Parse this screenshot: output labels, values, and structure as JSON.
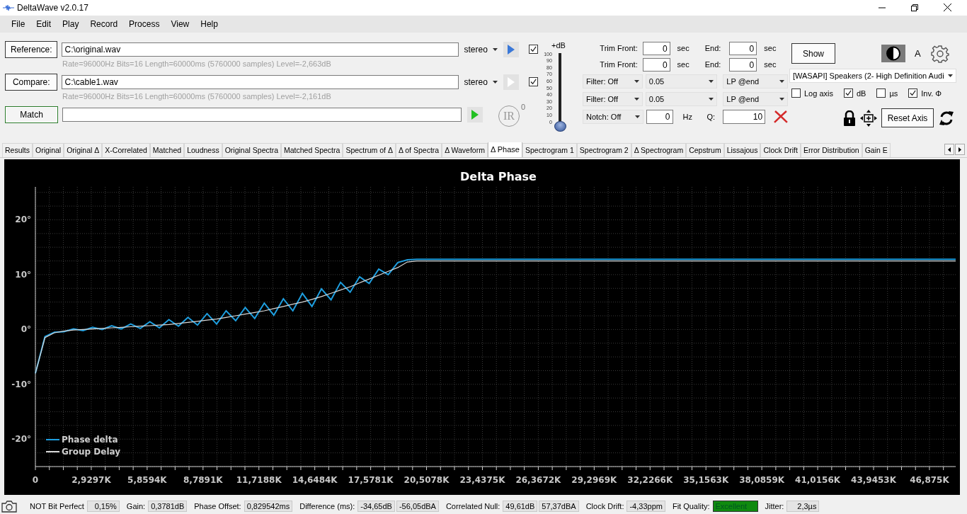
{
  "window": {
    "title": "DeltaWave v2.0.17"
  },
  "menu": [
    "File",
    "Edit",
    "Play",
    "Record",
    "Process",
    "View",
    "Help"
  ],
  "files": [
    {
      "button": "Reference:",
      "path": "C:\\original.wav",
      "info": "Rate=96000Hz Bits=16 Length=60000ms (5760000 samples) Level=-2,663dB",
      "channel": "stereo",
      "play_enabled": true,
      "checked": true
    },
    {
      "button": "Compare:",
      "path": "C:\\cable1.wav",
      "info": "Rate=96000Hz Bits=16 Length=60000ms (5760000 samples) Level=-2,161dB",
      "channel": "stereo",
      "play_enabled": false,
      "checked": true
    }
  ],
  "match": {
    "button": "Match"
  },
  "ir": {
    "label": "IR",
    "count": "0"
  },
  "volume": {
    "label": "+dB",
    "scale": [
      "100",
      "90",
      "80",
      "70",
      "60",
      "50",
      "40",
      "30",
      "20",
      "10",
      "0"
    ],
    "level": 0
  },
  "trims": [
    {
      "label": "Trim Front:",
      "value": "0",
      "unit": "sec",
      "end_label": "End:",
      "end_value": "0",
      "end_unit": "sec"
    },
    {
      "label": "Trim Front:",
      "value": "0",
      "unit": "sec",
      "end_label": "End:",
      "end_value": "0",
      "end_unit": "sec"
    }
  ],
  "filters": [
    {
      "filter": "Filter: Off",
      "frequency": "0.05",
      "mode": "LP @end"
    },
    {
      "filter": "Filter: Off",
      "frequency": "0.05",
      "mode": "LP @end"
    }
  ],
  "notch": {
    "filter": "Notch: Off",
    "value": "0",
    "unit": "Hz",
    "q_label": "Q:",
    "q_value": "10"
  },
  "show_button": "Show",
  "font_button": "A",
  "device": "[WASAPI] Speakers (2- High Definition Audi",
  "options": [
    {
      "label": "Log axis",
      "checked": false
    },
    {
      "label": "dB",
      "checked": true
    },
    {
      "label": "µs",
      "checked": false
    },
    {
      "label": "Inv. Φ",
      "checked": true
    }
  ],
  "reset_button": "Reset Axis",
  "tabs": [
    {
      "label": "Results",
      "selected": false
    },
    {
      "label": "Original",
      "selected": false
    },
    {
      "label": "Original Δ",
      "selected": false
    },
    {
      "label": "X-Correlated",
      "selected": false
    },
    {
      "label": "Matched",
      "selected": false
    },
    {
      "label": "Loudness",
      "selected": false
    },
    {
      "label": "Original Spectra",
      "selected": false
    },
    {
      "label": "Matched Spectra",
      "selected": false
    },
    {
      "label": "Spectrum of Δ",
      "selected": false
    },
    {
      "label": "Δ of Spectra",
      "selected": false
    },
    {
      "label": "Δ Waveform",
      "selected": false
    },
    {
      "label": "Δ Phase",
      "selected": true
    },
    {
      "label": "Spectrogram 1",
      "selected": false
    },
    {
      "label": "Spectrogram 2",
      "selected": false
    },
    {
      "label": "Δ Spectrogram",
      "selected": false
    },
    {
      "label": "Cepstrum",
      "selected": false
    },
    {
      "label": "Lissajous",
      "selected": false
    },
    {
      "label": "Clock Drift",
      "selected": false
    },
    {
      "label": "Error Distribution",
      "selected": false
    },
    {
      "label": "Gain E",
      "selected": false
    }
  ],
  "chart": {
    "chart_data": {
      "type": "line",
      "title": "Delta Phase",
      "x": [
        0,
        500,
        1000,
        1500,
        2000,
        2500,
        3000,
        3500,
        4000,
        4500,
        5000,
        5500,
        6000,
        6500,
        7000,
        7500,
        8000,
        8500,
        9000,
        9500,
        10000,
        10500,
        11000,
        11500,
        12000,
        12500,
        13000,
        13500,
        14000,
        14500,
        15000,
        15500,
        16000,
        16500,
        17000,
        17500,
        18000,
        18500,
        19000,
        19500,
        20000,
        48250
      ],
      "series": [
        {
          "name": "Phase delta",
          "color": "#1e9fe0",
          "values": [
            -8,
            -1.3,
            -0.5,
            -0.4,
            0.1,
            -0.2,
            0.4,
            0.0,
            0.7,
            0.1,
            1.0,
            0.2,
            1.4,
            0.3,
            1.8,
            0.6,
            2.2,
            0.8,
            2.9,
            1.0,
            3.4,
            1.6,
            4.0,
            2.0,
            4.8,
            2.6,
            5.6,
            3.4,
            6.6,
            4.2,
            7.4,
            5.4,
            8.6,
            6.8,
            9.6,
            8.4,
            11.0,
            10.0,
            12.2,
            12.7,
            12.8,
            12.8
          ]
        },
        {
          "name": "Group Delay",
          "color": "#d8d8d8",
          "values": [
            -8,
            -1.5,
            -0.6,
            -0.3,
            -0.1,
            0,
            0.1,
            0.2,
            0.3,
            0.4,
            0.5,
            0.6,
            0.7,
            0.8,
            0.9,
            1.1,
            1.3,
            1.5,
            1.7,
            1.9,
            2.2,
            2.5,
            2.8,
            3.1,
            3.4,
            3.8,
            4.2,
            4.6,
            5.0,
            5.5,
            6.0,
            6.6,
            7.2,
            7.8,
            8.5,
            9.2,
            9.9,
            10.6,
            11.3,
            12.3,
            12.5,
            12.5
          ]
        }
      ],
      "xlim": [
        0,
        48250
      ],
      "ylim": [
        -25,
        26
      ],
      "grid": true,
      "legend": true,
      "xticks": [
        {
          "value": 0,
          "label": "0"
        },
        {
          "value": 2929.6875,
          "label": "2,9297K"
        },
        {
          "value": 5859.375,
          "label": "5,8594K"
        },
        {
          "value": 8789.0625,
          "label": "8,7891K"
        },
        {
          "value": 11718.75,
          "label": "11,7188K"
        },
        {
          "value": 14648.4375,
          "label": "14,6484K"
        },
        {
          "value": 17578.125,
          "label": "17,5781K"
        },
        {
          "value": 20507.8125,
          "label": "20,5078K"
        },
        {
          "value": 23437.5,
          "label": "23,4375K"
        },
        {
          "value": 26367.1875,
          "label": "26,3672K"
        },
        {
          "value": 29296.875,
          "label": "29,2969K"
        },
        {
          "value": 32226.5625,
          "label": "32,2266K"
        },
        {
          "value": 35156.25,
          "label": "35,1563K"
        },
        {
          "value": 38085.9375,
          "label": "38,0859K"
        },
        {
          "value": 41015.625,
          "label": "41,0156K"
        },
        {
          "value": 43945.3125,
          "label": "43,9453K"
        },
        {
          "value": 46875,
          "label": "46,875K"
        }
      ],
      "yticks": [
        {
          "value": 20,
          "label": "20°"
        },
        {
          "value": 10,
          "label": "10°"
        },
        {
          "value": 0,
          "label": "0°"
        },
        {
          "value": -10,
          "label": "-10°"
        },
        {
          "value": -20,
          "label": "-20°"
        }
      ]
    }
  },
  "status": [
    {
      "label": "NOT Bit Perfect",
      "values": [
        "0,15%"
      ]
    },
    {
      "label": "Gain:",
      "values": [
        "0,3781dB"
      ]
    },
    {
      "label": "Phase Offset:",
      "values": [
        "0,829542ms"
      ]
    },
    {
      "label": "Difference (ms):",
      "values": [
        "-34,65dB",
        "-56,05dBA"
      ]
    },
    {
      "label": "Correlated Null:",
      "values": [
        "49,61dB",
        "57,37dBA"
      ]
    },
    {
      "label": "Clock Drift:",
      "values": [
        "-4,33ppm"
      ]
    },
    {
      "label": "Fit Quality:",
      "values": [
        "Excellent"
      ],
      "color": "#0f8a0f"
    },
    {
      "label": "Jitter:",
      "values": [
        "2,3µs"
      ]
    }
  ]
}
